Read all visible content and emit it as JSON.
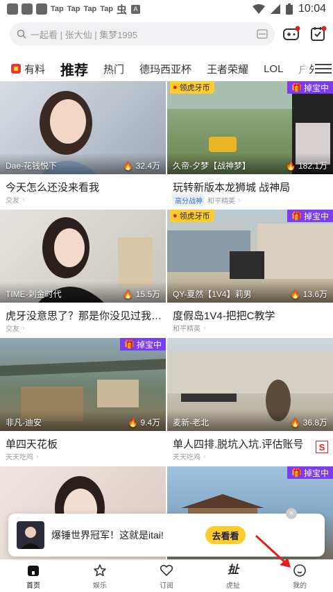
{
  "status_bar": {
    "tap_labels": [
      "Tap",
      "Tap",
      "Tap",
      "Tap"
    ],
    "time": "10:04"
  },
  "search": {
    "placeholder": "一起看 | 张大仙 | 集梦1995"
  },
  "tabs": [
    {
      "label": "有料"
    },
    {
      "label": "推荐"
    },
    {
      "label": "热门"
    },
    {
      "label": "德玛西亚杯"
    },
    {
      "label": "王者荣耀"
    },
    {
      "label": "LOL"
    },
    {
      "label": "户外"
    }
  ],
  "cards": [
    {
      "streamer": "Dae-花钱悦下",
      "views": "32.4万",
      "title": "今天怎么还没来看我",
      "category": "交友",
      "badge": "",
      "tag_huya": "",
      "tag_duobao": ""
    },
    {
      "streamer": "久帝-夕梦【战神梦】",
      "views": "182.1万",
      "title": "玩转新版本龙狮城 战神局",
      "category": "和平精英",
      "badge": "高分战神",
      "tag_huya": "领虎牙币",
      "tag_duobao": "掉宝中"
    },
    {
      "streamer": "TIME-刺金时代",
      "views": "15.5万",
      "title": "虎牙没意思了？那是你没见过我这...",
      "category": "交友",
      "badge": "",
      "tag_huya": "",
      "tag_duobao": ""
    },
    {
      "streamer": "QY-夏然【1V4】莉男",
      "views": "13.6万",
      "title": "度假岛1V4-把把C教学",
      "category": "和平精英",
      "badge": "",
      "tag_huya": "领虎牙币",
      "tag_duobao": "掉宝中"
    },
    {
      "streamer": "非凡-迪安",
      "views": "9.4万",
      "title": "单四天花板",
      "category": "天天吃鸡",
      "badge": "",
      "tag_huya": "",
      "tag_duobao": "掉宝中"
    },
    {
      "streamer": "麦新-老北",
      "views": "36.8万",
      "title": "单人四排.脱坑入坑.评估账号",
      "category": "天天吃鸡",
      "badge": "",
      "tag_huya": "",
      "tag_duobao": ""
    },
    {
      "streamer": "",
      "views": "",
      "title": "",
      "category": "",
      "badge": "",
      "tag_huya": "",
      "tag_duobao": ""
    },
    {
      "streamer": "",
      "views": "",
      "title": "",
      "category": "",
      "badge": "",
      "tag_huya": "",
      "tag_duobao": "掉宝中"
    }
  ],
  "popup": {
    "message": "爆锤世界冠军！这就是itai!",
    "button": "去看看"
  },
  "bottom_nav": [
    {
      "label": "首页"
    },
    {
      "label": "娱乐"
    },
    {
      "label": "订阅"
    },
    {
      "label": "虎扯"
    },
    {
      "label": "我的"
    }
  ],
  "colors": {
    "accent_yellow": "#ffcc2e",
    "duobao_purple": "#7b3cf2",
    "arrow_red": "#e02020"
  }
}
